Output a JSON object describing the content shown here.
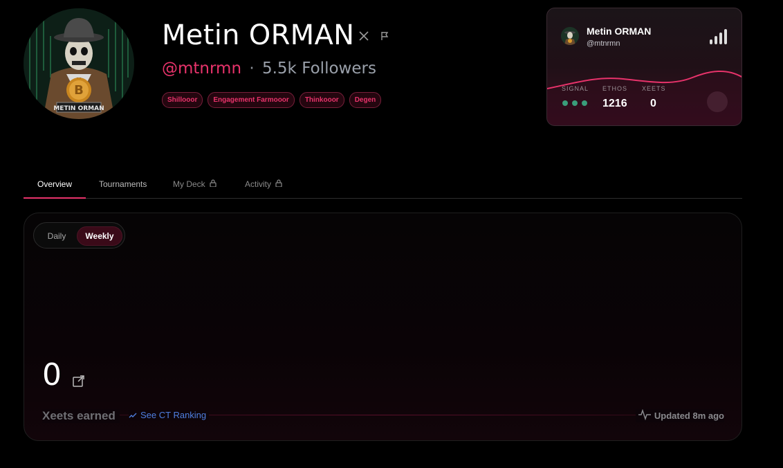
{
  "profile": {
    "name": "Metin ORMAN",
    "handle": "@mtnrmn",
    "separator": "·",
    "followers": "5.5k Followers",
    "avatar_caption": "METIN ORMAN",
    "tags": [
      "Shillooor",
      "Engagement Farmooor",
      "Thinkooor",
      "Degen"
    ]
  },
  "card": {
    "name": "Metin ORMAN",
    "handle": "@mtnrmn",
    "stats": {
      "signal_label": "SIGNAL",
      "ethos_label": "ETHOS",
      "ethos_value": "1216",
      "xeets_label": "XEETS",
      "xeets_value": "0"
    },
    "signal_level": 3,
    "colors": {
      "accent": "#e8336b",
      "signal": "#3a9d7a"
    }
  },
  "tabs": [
    {
      "label": "Overview",
      "active": true,
      "locked": false
    },
    {
      "label": "Tournaments",
      "active": false,
      "locked": false
    },
    {
      "label": "My Deck",
      "active": false,
      "locked": true
    },
    {
      "label": "Activity",
      "active": false,
      "locked": true
    }
  ],
  "panel": {
    "toggle": {
      "daily": "Daily",
      "weekly": "Weekly",
      "selected": "Weekly"
    },
    "value": "0",
    "xeets_label": "Xeets earned",
    "ct_link": "See CT Ranking",
    "updated": "Updated 8m ago"
  },
  "icons": {
    "x_logo": "x-logo-icon",
    "flag": "flag-icon",
    "lock": "lock-icon",
    "external": "external-link-icon",
    "trend": "trending-icon",
    "pulse": "activity-pulse-icon",
    "signal_bars": "signal-bars-icon"
  }
}
